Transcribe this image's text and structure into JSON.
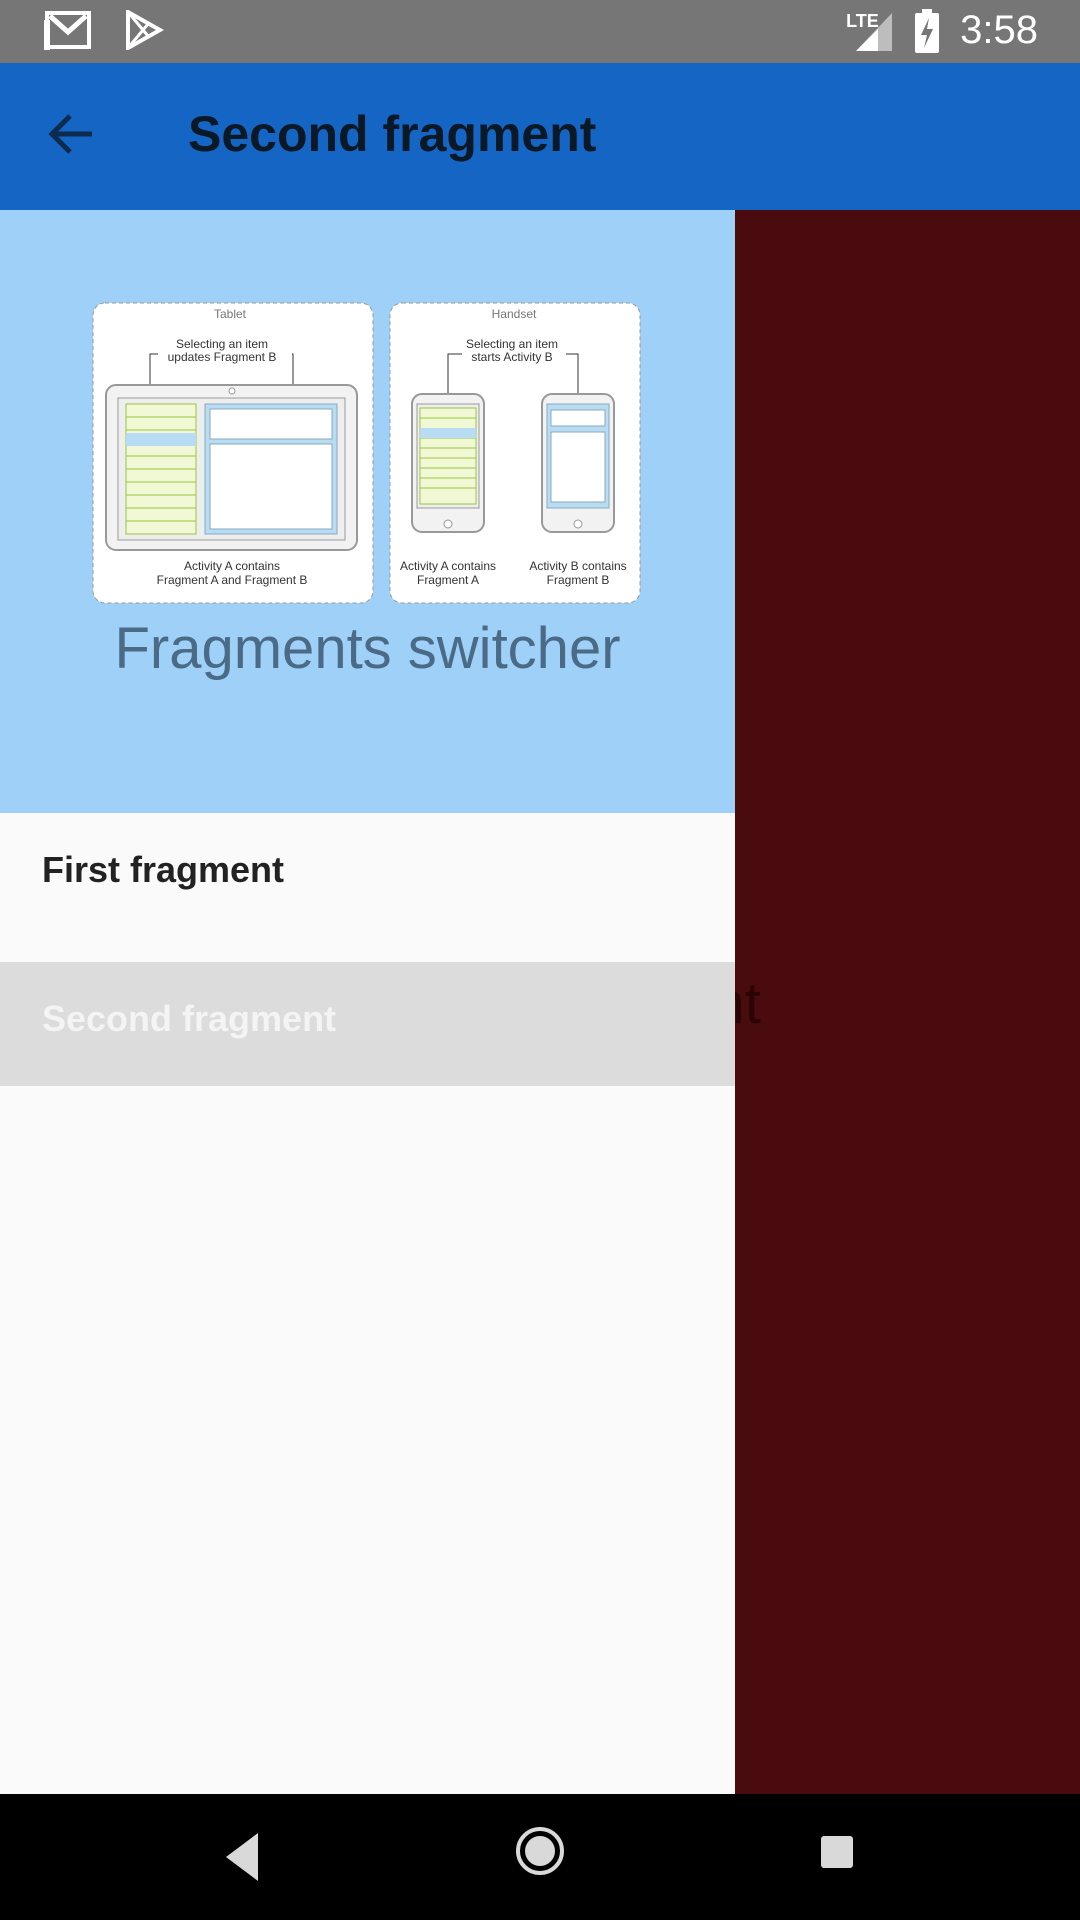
{
  "status_bar": {
    "time": "3:58",
    "network_label": "LTE",
    "icons": [
      "gmail-icon",
      "play-store-icon",
      "signal-icon",
      "battery-charging-icon"
    ]
  },
  "app_bar": {
    "title": "Second fragment",
    "back_icon": "arrow-back-icon"
  },
  "main": {
    "text": "Second fragment"
  },
  "drawer": {
    "header_title": "Fragments switcher",
    "diagram": {
      "tablet_label": "Tablet",
      "handset_label": "Handset",
      "tablet_callout_1": "Selecting an item",
      "tablet_callout_2": "updates Fragment B",
      "handset_callout_1": "Selecting an item",
      "handset_callout_2": "starts Activity B",
      "tablet_caption_1": "Activity A contains",
      "tablet_caption_2": "Fragment A and Fragment B",
      "handset_a_caption_1": "Activity A contains",
      "handset_a_caption_2": "Fragment A",
      "handset_b_caption_1": "Activity B contains",
      "handset_b_caption_2": "Fragment B"
    },
    "items": [
      {
        "label": "First fragment",
        "selected": false
      },
      {
        "label": "Second fragment",
        "selected": true
      }
    ]
  },
  "nav_bar": {
    "icons": [
      "back-triangle-icon",
      "home-circle-icon",
      "recents-square-icon"
    ]
  },
  "colors": {
    "app_bar": "#1565c4",
    "drawer_header": "#9fd0f8",
    "main_background": "#4a0b0e",
    "selected_item": "#dcdcdc"
  }
}
